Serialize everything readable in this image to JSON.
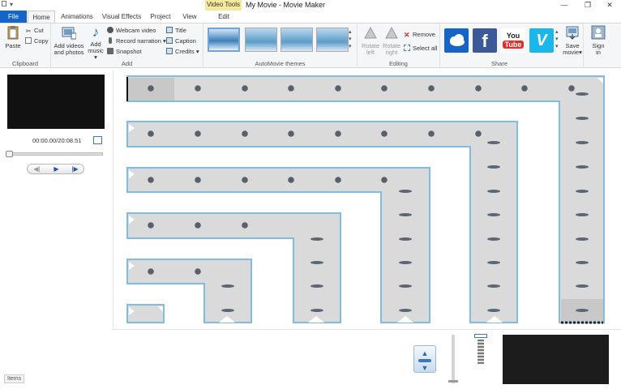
{
  "window": {
    "title": "My Movie - Movie Maker",
    "contextual_tab_header": "Video Tools",
    "qat_label": "▾",
    "min_glyph": "—",
    "max_glyph": "❐",
    "close_glyph": "✕"
  },
  "tabs": [
    {
      "label": "File"
    },
    {
      "label": "Home"
    },
    {
      "label": "Animations"
    },
    {
      "label": "Visual Effects"
    },
    {
      "label": "Project"
    },
    {
      "label": "View"
    },
    {
      "label": "Edit"
    }
  ],
  "ribbon": {
    "clipboard": {
      "label": "Clipboard",
      "paste": "Paste",
      "cut": "Cut",
      "copy": "Copy"
    },
    "add": {
      "label": "Add",
      "add_videos_line1": "Add videos",
      "add_videos_line2": "and photos",
      "add_music_line1": "Add",
      "add_music_line2": "music",
      "webcam_video": "Webcam video",
      "record_narration": "Record narration",
      "snapshot": "Snapshot",
      "title": "Title",
      "caption": "Caption",
      "credits": "Credits"
    },
    "themes": {
      "label": "AutoMovie themes"
    },
    "editing": {
      "label": "Editing",
      "rotate_left_line1": "Rotate",
      "rotate_left_line2": "left",
      "rotate_right_line1": "Rotate",
      "rotate_right_line2": "right",
      "remove": "Remove",
      "select_all": "Select all"
    },
    "share": {
      "label": "Share",
      "facebook": "f",
      "youtube_top": "You",
      "youtube_bottom": "Tube",
      "vimeo": "V",
      "save_movie_line1": "Save",
      "save_movie_line2": "movie",
      "sign_in_line1": "Sign",
      "sign_in_line2": "in"
    }
  },
  "preview": {
    "time": "00:00.00/20:08.51",
    "prev_frame": "◀|",
    "play": "▶",
    "next_frame": "|▶"
  },
  "status": {
    "items_label": "Items"
  },
  "colors": {
    "file_tab": "#1565c8",
    "context_tab": "#f5ea9c",
    "strip_border": "#7fbde2",
    "strip_fill": "#dadada",
    "facebook": "#3b5998",
    "youtube": "#e52d27",
    "vimeo": "#1ab7ea",
    "onedrive": "#1565c8"
  }
}
